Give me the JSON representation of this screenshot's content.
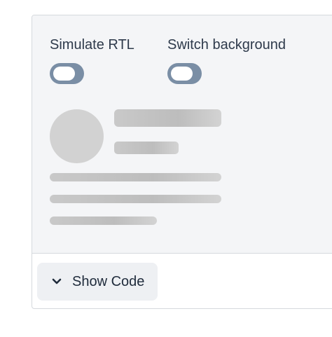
{
  "toggles": [
    {
      "label": "Simulate RTL",
      "checked": false
    },
    {
      "label": "Switch background",
      "checked": false
    }
  ],
  "footer": {
    "show_code_label": "Show Code",
    "icon": "chevron-down-icon"
  },
  "colors": {
    "preview_background": "#f4f5f7",
    "switch_track": "#7a8ea5",
    "skeleton": "#c9c9c9",
    "border": "#d5d9dd"
  }
}
